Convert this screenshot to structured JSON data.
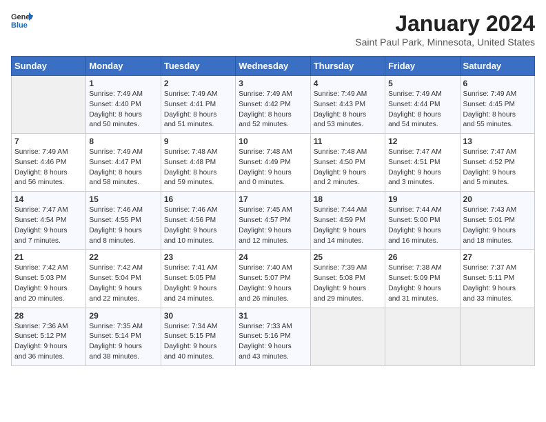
{
  "header": {
    "logo_general": "General",
    "logo_blue": "Blue",
    "month": "January 2024",
    "location": "Saint Paul Park, Minnesota, United States"
  },
  "weekdays": [
    "Sunday",
    "Monday",
    "Tuesday",
    "Wednesday",
    "Thursday",
    "Friday",
    "Saturday"
  ],
  "weeks": [
    [
      {
        "day": "",
        "detail": ""
      },
      {
        "day": "1",
        "detail": "Sunrise: 7:49 AM\nSunset: 4:40 PM\nDaylight: 8 hours\nand 50 minutes."
      },
      {
        "day": "2",
        "detail": "Sunrise: 7:49 AM\nSunset: 4:41 PM\nDaylight: 8 hours\nand 51 minutes."
      },
      {
        "day": "3",
        "detail": "Sunrise: 7:49 AM\nSunset: 4:42 PM\nDaylight: 8 hours\nand 52 minutes."
      },
      {
        "day": "4",
        "detail": "Sunrise: 7:49 AM\nSunset: 4:43 PM\nDaylight: 8 hours\nand 53 minutes."
      },
      {
        "day": "5",
        "detail": "Sunrise: 7:49 AM\nSunset: 4:44 PM\nDaylight: 8 hours\nand 54 minutes."
      },
      {
        "day": "6",
        "detail": "Sunrise: 7:49 AM\nSunset: 4:45 PM\nDaylight: 8 hours\nand 55 minutes."
      }
    ],
    [
      {
        "day": "7",
        "detail": "Sunrise: 7:49 AM\nSunset: 4:46 PM\nDaylight: 8 hours\nand 56 minutes."
      },
      {
        "day": "8",
        "detail": "Sunrise: 7:49 AM\nSunset: 4:47 PM\nDaylight: 8 hours\nand 58 minutes."
      },
      {
        "day": "9",
        "detail": "Sunrise: 7:48 AM\nSunset: 4:48 PM\nDaylight: 8 hours\nand 59 minutes."
      },
      {
        "day": "10",
        "detail": "Sunrise: 7:48 AM\nSunset: 4:49 PM\nDaylight: 9 hours\nand 0 minutes."
      },
      {
        "day": "11",
        "detail": "Sunrise: 7:48 AM\nSunset: 4:50 PM\nDaylight: 9 hours\nand 2 minutes."
      },
      {
        "day": "12",
        "detail": "Sunrise: 7:47 AM\nSunset: 4:51 PM\nDaylight: 9 hours\nand 3 minutes."
      },
      {
        "day": "13",
        "detail": "Sunrise: 7:47 AM\nSunset: 4:52 PM\nDaylight: 9 hours\nand 5 minutes."
      }
    ],
    [
      {
        "day": "14",
        "detail": "Sunrise: 7:47 AM\nSunset: 4:54 PM\nDaylight: 9 hours\nand 7 minutes."
      },
      {
        "day": "15",
        "detail": "Sunrise: 7:46 AM\nSunset: 4:55 PM\nDaylight: 9 hours\nand 8 minutes."
      },
      {
        "day": "16",
        "detail": "Sunrise: 7:46 AM\nSunset: 4:56 PM\nDaylight: 9 hours\nand 10 minutes."
      },
      {
        "day": "17",
        "detail": "Sunrise: 7:45 AM\nSunset: 4:57 PM\nDaylight: 9 hours\nand 12 minutes."
      },
      {
        "day": "18",
        "detail": "Sunrise: 7:44 AM\nSunset: 4:59 PM\nDaylight: 9 hours\nand 14 minutes."
      },
      {
        "day": "19",
        "detail": "Sunrise: 7:44 AM\nSunset: 5:00 PM\nDaylight: 9 hours\nand 16 minutes."
      },
      {
        "day": "20",
        "detail": "Sunrise: 7:43 AM\nSunset: 5:01 PM\nDaylight: 9 hours\nand 18 minutes."
      }
    ],
    [
      {
        "day": "21",
        "detail": "Sunrise: 7:42 AM\nSunset: 5:03 PM\nDaylight: 9 hours\nand 20 minutes."
      },
      {
        "day": "22",
        "detail": "Sunrise: 7:42 AM\nSunset: 5:04 PM\nDaylight: 9 hours\nand 22 minutes."
      },
      {
        "day": "23",
        "detail": "Sunrise: 7:41 AM\nSunset: 5:05 PM\nDaylight: 9 hours\nand 24 minutes."
      },
      {
        "day": "24",
        "detail": "Sunrise: 7:40 AM\nSunset: 5:07 PM\nDaylight: 9 hours\nand 26 minutes."
      },
      {
        "day": "25",
        "detail": "Sunrise: 7:39 AM\nSunset: 5:08 PM\nDaylight: 9 hours\nand 29 minutes."
      },
      {
        "day": "26",
        "detail": "Sunrise: 7:38 AM\nSunset: 5:09 PM\nDaylight: 9 hours\nand 31 minutes."
      },
      {
        "day": "27",
        "detail": "Sunrise: 7:37 AM\nSunset: 5:11 PM\nDaylight: 9 hours\nand 33 minutes."
      }
    ],
    [
      {
        "day": "28",
        "detail": "Sunrise: 7:36 AM\nSunset: 5:12 PM\nDaylight: 9 hours\nand 36 minutes."
      },
      {
        "day": "29",
        "detail": "Sunrise: 7:35 AM\nSunset: 5:14 PM\nDaylight: 9 hours\nand 38 minutes."
      },
      {
        "day": "30",
        "detail": "Sunrise: 7:34 AM\nSunset: 5:15 PM\nDaylight: 9 hours\nand 40 minutes."
      },
      {
        "day": "31",
        "detail": "Sunrise: 7:33 AM\nSunset: 5:16 PM\nDaylight: 9 hours\nand 43 minutes."
      },
      {
        "day": "",
        "detail": ""
      },
      {
        "day": "",
        "detail": ""
      },
      {
        "day": "",
        "detail": ""
      }
    ]
  ]
}
